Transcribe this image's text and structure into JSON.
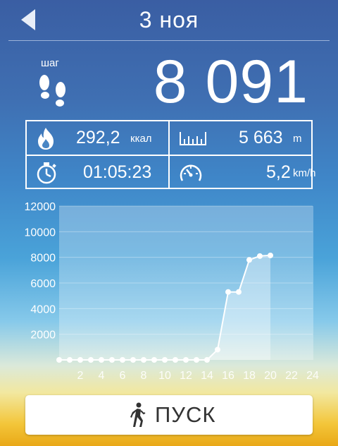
{
  "header": {
    "date": "3 ноя"
  },
  "steps": {
    "label": "шаг",
    "value": "8 091"
  },
  "stats": {
    "calories": {
      "value": "292,2",
      "unit": "ккал"
    },
    "distance": {
      "value": "5 663",
      "unit": "m"
    },
    "duration": {
      "value": "01:05:23"
    },
    "speed": {
      "value": "5,2",
      "unit": "km/h"
    }
  },
  "chart_data": {
    "type": "line",
    "x": [
      0,
      1,
      2,
      3,
      4,
      5,
      6,
      7,
      8,
      9,
      10,
      11,
      12,
      13,
      14,
      15,
      16,
      17,
      18,
      19,
      20
    ],
    "values": [
      0,
      0,
      0,
      0,
      0,
      0,
      0,
      0,
      0,
      0,
      0,
      0,
      0,
      0,
      0,
      800,
      5300,
      5300,
      7800,
      8100,
      8150
    ],
    "ylim": [
      0,
      12000
    ],
    "xlim": [
      0,
      24
    ],
    "y_ticks": [
      "2000",
      "4000",
      "6000",
      "8000",
      "10000",
      "12000"
    ],
    "x_ticks": [
      "2",
      "4",
      "6",
      "8",
      "10",
      "12",
      "14",
      "16",
      "18",
      "20",
      "22",
      "24"
    ],
    "grid": true
  },
  "button": {
    "label": "ПУСК"
  },
  "icons": {
    "back": "back-arrow-icon",
    "steps": "footprints-icon",
    "calories": "flame-icon",
    "distance": "ruler-icon",
    "duration": "stopwatch-icon",
    "speed": "speedometer-icon",
    "start": "walking-person-icon"
  }
}
